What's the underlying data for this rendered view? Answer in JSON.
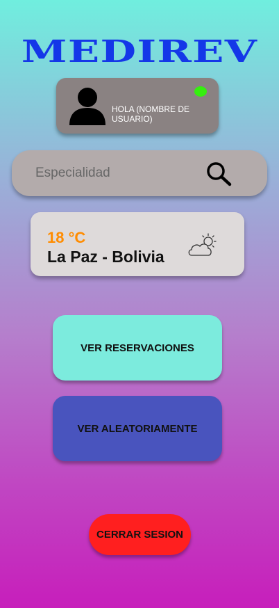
{
  "app": {
    "title": "MEDIREV"
  },
  "user_card": {
    "greeting": "HOLA (NOMBRE DE USUARIO)",
    "avatar_icon": "user-silhouette-icon",
    "status": "online",
    "status_color": "#35F00F"
  },
  "search": {
    "placeholder": "Especialidad",
    "value": "",
    "icon": "search-icon"
  },
  "weather": {
    "temperature": "18 °C",
    "location": "La Paz - Bolivia",
    "icon": "partly-cloudy-icon"
  },
  "actions": {
    "reservations_label": "VER RESERVACIONES",
    "random_label": "VER ALEATORIAMENTE",
    "logout_label": "CERRAR SESION"
  },
  "colors": {
    "brand": "#1437E8",
    "reservations_button": "#7CEBDD",
    "random_button": "#4954BE",
    "logout_button": "#FF1F1F",
    "temperature": "#FF8C00"
  }
}
